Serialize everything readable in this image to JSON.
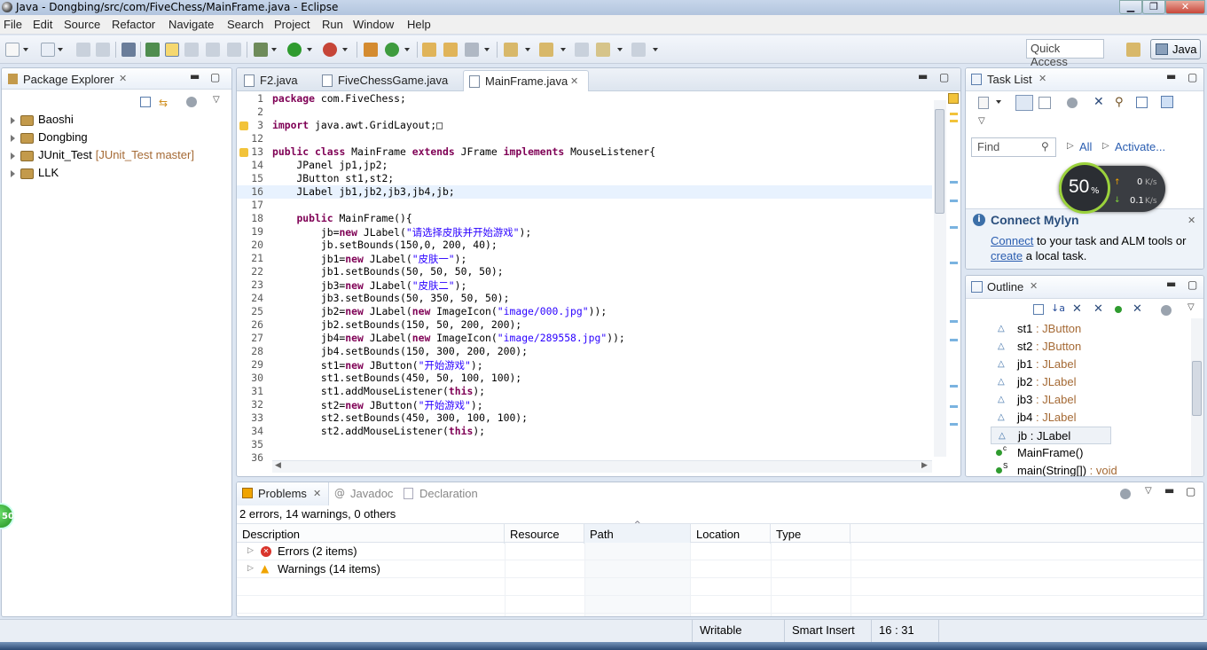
{
  "window": {
    "title": "Java - Dongbing/src/com/FiveChess/MainFrame.java - Eclipse",
    "minimize": "▁",
    "maximize": "❐",
    "close": "✕"
  },
  "menu": [
    "File",
    "Edit",
    "Source",
    "Refactor",
    "Navigate",
    "Search",
    "Project",
    "Run",
    "Window",
    "Help"
  ],
  "toolbar": {
    "quick_access": "Quick Access",
    "perspective": "Java"
  },
  "package_explorer": {
    "title": "Package Explorer",
    "projects": [
      {
        "name": "Baoshi",
        "decoration": ""
      },
      {
        "name": "Dongbing",
        "decoration": ""
      },
      {
        "name": "JUnit_Test",
        "decoration": "[JUnit_Test master]"
      },
      {
        "name": "LLK",
        "decoration": ""
      }
    ]
  },
  "editor": {
    "tabs": [
      {
        "label": "F2.java",
        "active": false
      },
      {
        "label": "FiveChessGame.java",
        "active": false
      },
      {
        "label": "MainFrame.java",
        "active": true
      }
    ],
    "lines": [
      {
        "n": "1",
        "text": "package com.FiveChess;"
      },
      {
        "n": "2",
        "text": ""
      },
      {
        "n": "3",
        "text": "import java.awt.GridLayout;□"
      },
      {
        "n": "12",
        "text": ""
      },
      {
        "n": "13",
        "text": "public class MainFrame extends JFrame implements MouseListener{"
      },
      {
        "n": "14",
        "text": "    JPanel jp1,jp2;"
      },
      {
        "n": "15",
        "text": "    JButton st1,st2;"
      },
      {
        "n": "16",
        "text": "    JLabel jb1,jb2,jb3,jb4,jb;"
      },
      {
        "n": "17",
        "text": ""
      },
      {
        "n": "18",
        "text": "    public MainFrame(){"
      },
      {
        "n": "19",
        "text": "        jb=new JLabel(\"请选择皮肤并开始游戏\");"
      },
      {
        "n": "20",
        "text": "        jb.setBounds(150,0, 200, 40);"
      },
      {
        "n": "21",
        "text": "        jb1=new JLabel(\"皮肤一\");"
      },
      {
        "n": "22",
        "text": "        jb1.setBounds(50, 50, 50, 50);"
      },
      {
        "n": "23",
        "text": "        jb3=new JLabel(\"皮肤二\");"
      },
      {
        "n": "24",
        "text": "        jb3.setBounds(50, 350, 50, 50);"
      },
      {
        "n": "25",
        "text": "        jb2=new JLabel(new ImageIcon(\"image/000.jpg\"));"
      },
      {
        "n": "26",
        "text": "        jb2.setBounds(150, 50, 200, 200);"
      },
      {
        "n": "27",
        "text": "        jb4=new JLabel(new ImageIcon(\"image/289558.jpg\"));"
      },
      {
        "n": "28",
        "text": "        jb4.setBounds(150, 300, 200, 200);"
      },
      {
        "n": "29",
        "text": "        st1=new JButton(\"开始游戏\");"
      },
      {
        "n": "30",
        "text": "        st1.setBounds(450, 50, 100, 100);"
      },
      {
        "n": "31",
        "text": "        st1.addMouseListener(this);"
      },
      {
        "n": "32",
        "text": "        st2=new JButton(\"开始游戏\");"
      },
      {
        "n": "33",
        "text": "        st2.setBounds(450, 300, 100, 100);"
      },
      {
        "n": "34",
        "text": "        st2.addMouseListener(this);"
      },
      {
        "n": "35",
        "text": ""
      },
      {
        "n": "36",
        "text": ""
      }
    ]
  },
  "task_list": {
    "title": "Task List",
    "find_placeholder": "Find",
    "all": "All",
    "activate": "Activate..."
  },
  "net_widget": {
    "percent": "50",
    "percent_sign": "%",
    "up": "0",
    "down": "0.1",
    "unit": "K/s"
  },
  "mylyn": {
    "title": "Connect Mylyn",
    "connect_link": "Connect",
    "connect_text": " to your task and ALM tools or",
    "create_link": "create",
    "create_text": " a local task."
  },
  "outline": {
    "title": "Outline",
    "items": [
      {
        "name": "st1",
        "type": " : JButton"
      },
      {
        "name": "st2",
        "type": " : JButton"
      },
      {
        "name": "jb1",
        "type": " : JLabel"
      },
      {
        "name": "jb2",
        "type": " : JLabel"
      },
      {
        "name": "jb3",
        "type": " : JLabel"
      },
      {
        "name": "jb4",
        "type": " : JLabel"
      },
      {
        "name": "jb : JLabel",
        "type": ""
      },
      {
        "name": "MainFrame()",
        "type": ""
      },
      {
        "name": "main(String[])",
        "type": " : void"
      }
    ],
    "superscripts": {
      "constructor": "c",
      "static": "S"
    }
  },
  "problems": {
    "tabs": {
      "problems": "Problems",
      "javadoc": "Javadoc",
      "declaration": "Declaration"
    },
    "summary": "2 errors, 14 warnings, 0 others",
    "columns": [
      "Description",
      "Resource",
      "Path",
      "Location",
      "Type"
    ],
    "rows": [
      {
        "label": "Errors (2 items)"
      },
      {
        "label": "Warnings (14 items)"
      }
    ]
  },
  "status": {
    "writable": "Writable",
    "insert_mode": "Smart Insert",
    "position": "16 : 31"
  },
  "side_badge": "50",
  "colors": {
    "accent": "#3c6fa8",
    "keyword": "#7f0055",
    "string": "#2a00ff",
    "field": "#0000c0",
    "link": "#2a5db0",
    "error": "#d9342b",
    "warning": "#f0a400"
  }
}
